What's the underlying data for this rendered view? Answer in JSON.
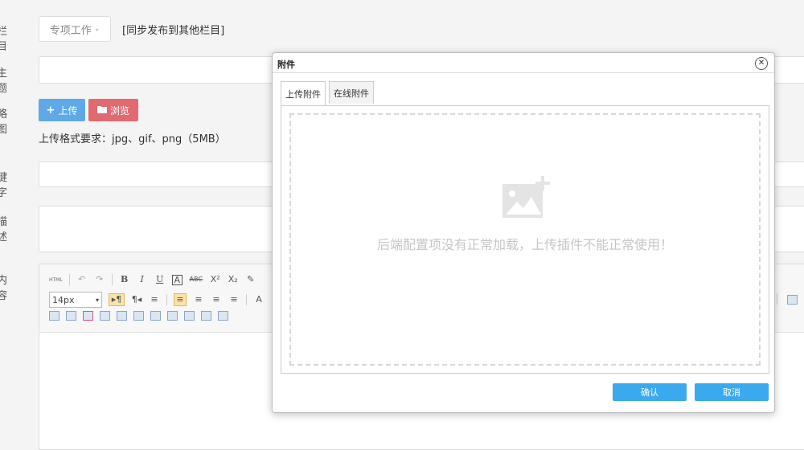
{
  "form": {
    "labels": {
      "column": "栏目",
      "subject": "主题",
      "thumbnail": "略图",
      "keyword": "键字",
      "desc": "描述",
      "content": "内容"
    },
    "column_select": "专项工作",
    "sync_text": "[同步发布到其他栏目]",
    "upload_label": "上传",
    "browse_label": "浏览",
    "format_hint": "上传格式要求：jpg、gif、png（5MB）"
  },
  "editor": {
    "font_size": "14px",
    "html_label": "HTML"
  },
  "dialog": {
    "title": "附件",
    "tabs": [
      "上传附件",
      "在线附件"
    ],
    "error_message": "后端配置项没有正常加载，上传插件不能正常使用！",
    "ok_label": "确认",
    "cancel_label": "取消"
  },
  "icons": {
    "close": "close-circle-icon",
    "upload": "plus-icon",
    "browse": "folder-icon",
    "placeholder": "image-add-icon"
  },
  "colors": {
    "upload_button": "#5fa9e8",
    "browse_button": "#e06a70",
    "dialog_button": "#3aa9ee"
  }
}
